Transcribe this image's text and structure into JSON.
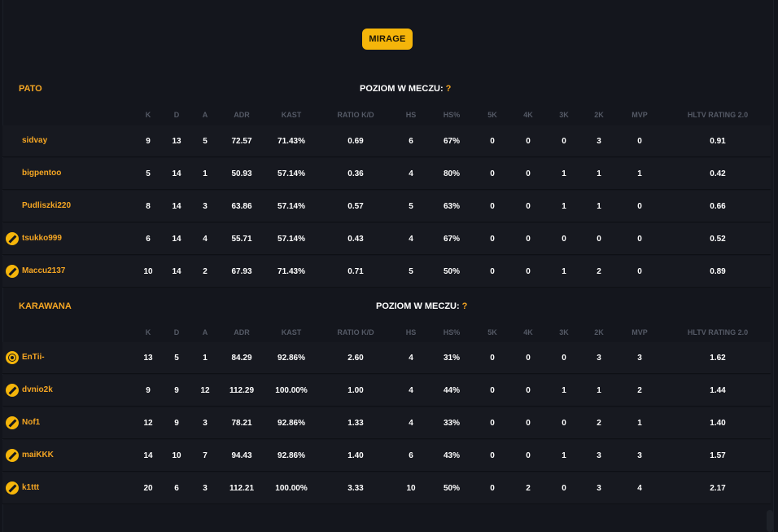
{
  "map": {
    "label": "MIRAGE"
  },
  "level_label": "POZIOM W MECZU:",
  "level_value": "?",
  "columns": [
    "K",
    "D",
    "A",
    "ADR",
    "KAST",
    "RATIO K/D",
    "HS",
    "HS%",
    "5K",
    "4K",
    "3K",
    "2K",
    "MVP",
    "HLTV RATING 2.0"
  ],
  "colors": {
    "accent": "#f5a623",
    "button": "#f5b50a",
    "background": "#14161d",
    "row": "#171920"
  },
  "teams": [
    {
      "name": "PATO",
      "players": [
        {
          "name": "sidvay",
          "avatar": "none",
          "stats": [
            "9",
            "13",
            "5",
            "72.57",
            "71.43%",
            "0.69",
            "6",
            "67%",
            "0",
            "0",
            "0",
            "3",
            "0",
            "0.91"
          ]
        },
        {
          "name": "bigpentoo",
          "avatar": "none",
          "stats": [
            "5",
            "14",
            "1",
            "50.93",
            "57.14%",
            "0.36",
            "4",
            "80%",
            "0",
            "0",
            "1",
            "1",
            "1",
            "0.42"
          ]
        },
        {
          "name": "Pudliszki220",
          "avatar": "none",
          "stats": [
            "8",
            "14",
            "3",
            "63.86",
            "57.14%",
            "0.57",
            "5",
            "63%",
            "0",
            "0",
            "1",
            "1",
            "0",
            "0.66"
          ]
        },
        {
          "name": "tsukko999",
          "avatar": "slash-badge-icon",
          "stats": [
            "6",
            "14",
            "4",
            "55.71",
            "57.14%",
            "0.43",
            "4",
            "67%",
            "0",
            "0",
            "0",
            "0",
            "0",
            "0.52"
          ]
        },
        {
          "name": "Maccu2137",
          "avatar": "slash-badge-icon",
          "stats": [
            "10",
            "14",
            "2",
            "67.93",
            "71.43%",
            "0.71",
            "5",
            "50%",
            "0",
            "0",
            "1",
            "2",
            "0",
            "0.89"
          ]
        }
      ]
    },
    {
      "name": "KARAWANA",
      "players": [
        {
          "name": "EnTii-",
          "avatar": "ring-badge-icon",
          "stats": [
            "13",
            "5",
            "1",
            "84.29",
            "92.86%",
            "2.60",
            "4",
            "31%",
            "0",
            "0",
            "0",
            "3",
            "3",
            "1.62"
          ]
        },
        {
          "name": "dvnio2k",
          "avatar": "slash-badge-icon",
          "stats": [
            "9",
            "9",
            "12",
            "112.29",
            "100.00%",
            "1.00",
            "4",
            "44%",
            "0",
            "0",
            "1",
            "1",
            "2",
            "1.44"
          ]
        },
        {
          "name": "Nof1",
          "avatar": "slash-badge-icon",
          "stats": [
            "12",
            "9",
            "3",
            "78.21",
            "92.86%",
            "1.33",
            "4",
            "33%",
            "0",
            "0",
            "0",
            "2",
            "1",
            "1.40"
          ]
        },
        {
          "name": "maiKKK",
          "avatar": "slash-badge-icon",
          "stats": [
            "14",
            "10",
            "7",
            "94.43",
            "92.86%",
            "1.40",
            "6",
            "43%",
            "0",
            "0",
            "1",
            "3",
            "3",
            "1.57"
          ]
        },
        {
          "name": "k1ttt",
          "avatar": "slash-badge-icon",
          "stats": [
            "20",
            "6",
            "3",
            "112.21",
            "100.00%",
            "3.33",
            "10",
            "50%",
            "0",
            "2",
            "0",
            "3",
            "4",
            "2.17"
          ]
        }
      ]
    }
  ]
}
